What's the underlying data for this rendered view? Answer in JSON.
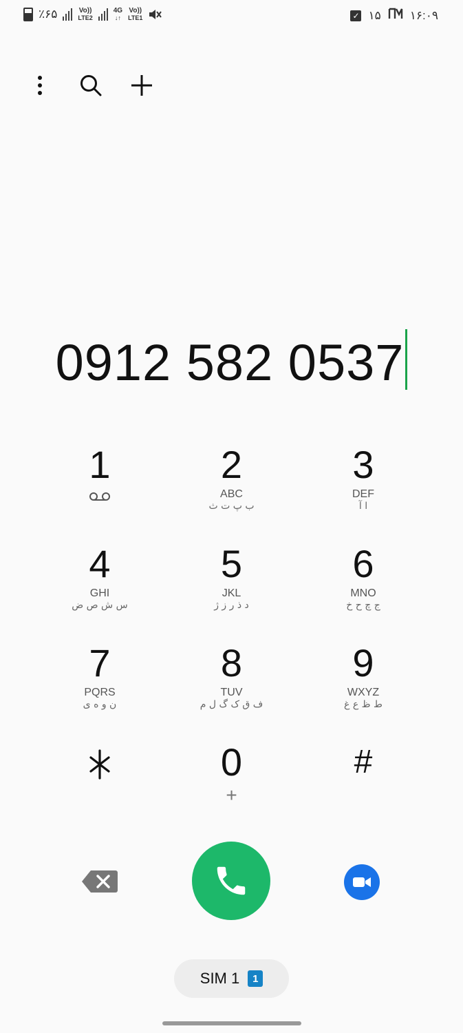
{
  "status_bar": {
    "battery": "٪۶۵",
    "lte2": "LTE2",
    "volte": "Vo))",
    "lte1": "LTE1",
    "net_4g": "4G",
    "date": "۱۵",
    "time": "۱۶:۰۹"
  },
  "toolbar": {
    "icons": [
      "more-vert-icon",
      "search-icon",
      "add-icon"
    ]
  },
  "dialer": {
    "number": "0912 582 0537"
  },
  "keys": [
    {
      "digit": "1",
      "latin": "",
      "persian": ""
    },
    {
      "digit": "2",
      "latin": "ABC",
      "persian": "ب پ ت ث"
    },
    {
      "digit": "3",
      "latin": "DEF",
      "persian": "ا آ"
    },
    {
      "digit": "4",
      "latin": "GHI",
      "persian": "س ش ص ض"
    },
    {
      "digit": "5",
      "latin": "JKL",
      "persian": "د ذ ر ز ژ"
    },
    {
      "digit": "6",
      "latin": "MNO",
      "persian": "ج چ ح خ"
    },
    {
      "digit": "7",
      "latin": "PQRS",
      "persian": "ن و ه ی"
    },
    {
      "digit": "8",
      "latin": "TUV",
      "persian": "ف ق ک گ ل م"
    },
    {
      "digit": "9",
      "latin": "WXYZ",
      "persian": "ط ظ ع غ"
    },
    {
      "digit": "*",
      "latin": "",
      "persian": ""
    },
    {
      "digit": "0",
      "latin": "+",
      "persian": ""
    },
    {
      "digit": "#",
      "latin": "",
      "persian": ""
    }
  ],
  "sim": {
    "label": "SIM 1",
    "badge": "1"
  },
  "colors": {
    "call": "#1db86a",
    "video": "#1a73e8",
    "cursor": "#1aa34a",
    "sim_badge": "#1683c6"
  }
}
